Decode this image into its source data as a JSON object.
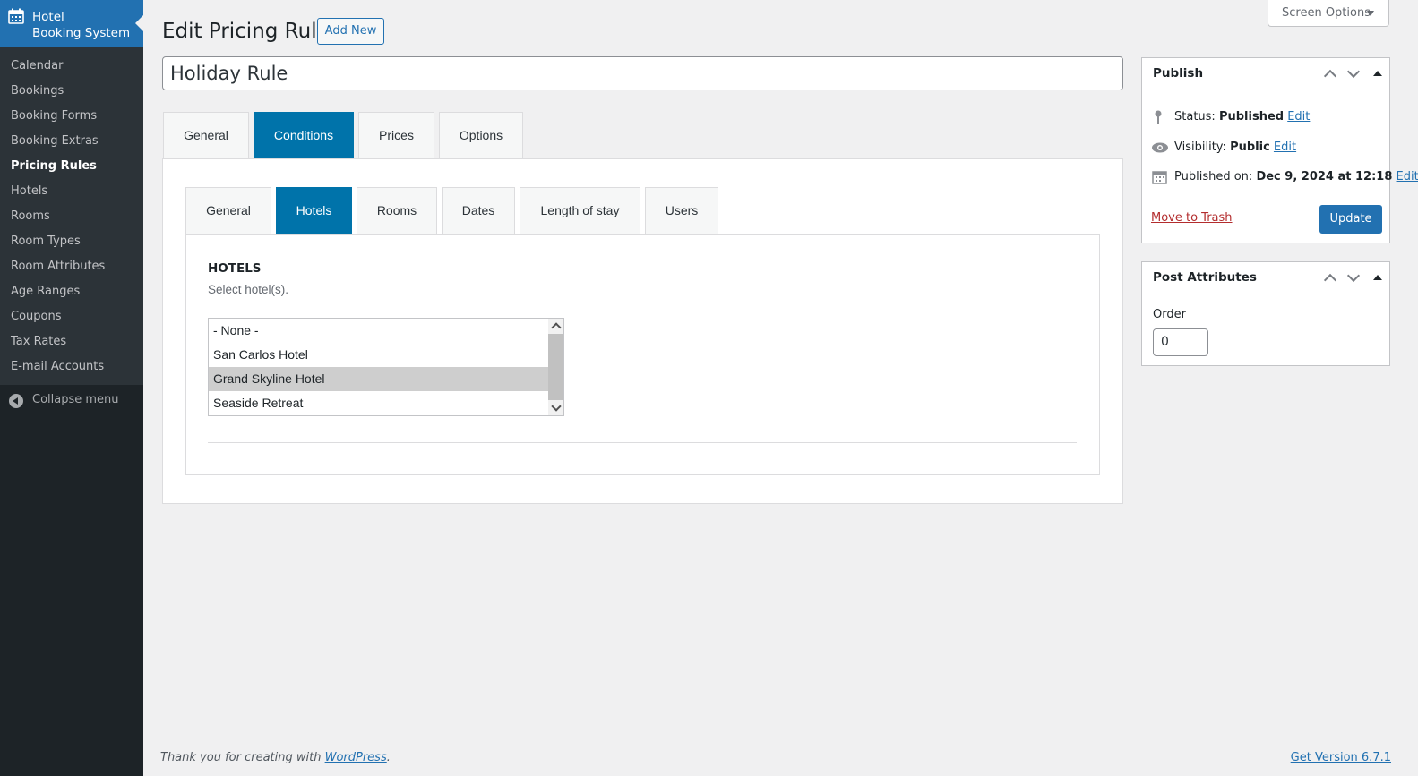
{
  "sidebar": {
    "plugin_title_line1": "Hotel",
    "plugin_title_line2": "Booking System",
    "items": [
      {
        "label": "Calendar"
      },
      {
        "label": "Bookings"
      },
      {
        "label": "Booking Forms"
      },
      {
        "label": "Booking Extras"
      },
      {
        "label": "Pricing Rules"
      },
      {
        "label": "Hotels"
      },
      {
        "label": "Rooms"
      },
      {
        "label": "Room Types"
      },
      {
        "label": "Room Attributes"
      },
      {
        "label": "Age Ranges"
      },
      {
        "label": "Coupons"
      },
      {
        "label": "Tax Rates"
      },
      {
        "label": "E-mail Accounts"
      }
    ],
    "current_item": "Pricing Rules",
    "collapse_label": "Collapse menu"
  },
  "header": {
    "title": "Edit Pricing Rule",
    "add_new_label": "Add New",
    "screen_options_label": "Screen Options"
  },
  "post": {
    "title_value": "Holiday Rule"
  },
  "outer_tabs": [
    {
      "label": "General"
    },
    {
      "label": "Conditions"
    },
    {
      "label": "Prices"
    },
    {
      "label": "Options"
    }
  ],
  "outer_active_tab": "Conditions",
  "inner_tabs": [
    {
      "label": "General"
    },
    {
      "label": "Hotels"
    },
    {
      "label": "Rooms"
    },
    {
      "label": "Dates"
    },
    {
      "label": "Length of stay"
    },
    {
      "label": "Users"
    }
  ],
  "inner_active_tab": "Hotels",
  "hotels_section": {
    "heading": "HOTELS",
    "description": "Select hotel(s).",
    "options": [
      {
        "label": "- None -"
      },
      {
        "label": "San Carlos Hotel"
      },
      {
        "label": "Grand Skyline Hotel"
      },
      {
        "label": "Seaside Retreat"
      }
    ],
    "selected": "Grand Skyline Hotel"
  },
  "publish_box": {
    "title": "Publish",
    "status_label": "Status:",
    "status_value": "Published",
    "visibility_label": "Visibility:",
    "visibility_value": "Public",
    "published_label": "Published on:",
    "published_value": "Dec 9, 2024 at 12:18",
    "edit_label": "Edit",
    "trash_label": "Move to Trash",
    "update_label": "Update"
  },
  "attributes_box": {
    "title": "Post Attributes",
    "order_label": "Order",
    "order_value": "0"
  },
  "footer": {
    "thanks_text": "Thank you for creating with",
    "wordpress_link": "WordPress",
    "period": ".",
    "version_link": "Get Version 6.7.1"
  },
  "colors": {
    "accent": "#2271b1",
    "tab_active": "#0073aa",
    "sidebar_bg": "#1d2327",
    "trash_red": "#b32d2e"
  }
}
